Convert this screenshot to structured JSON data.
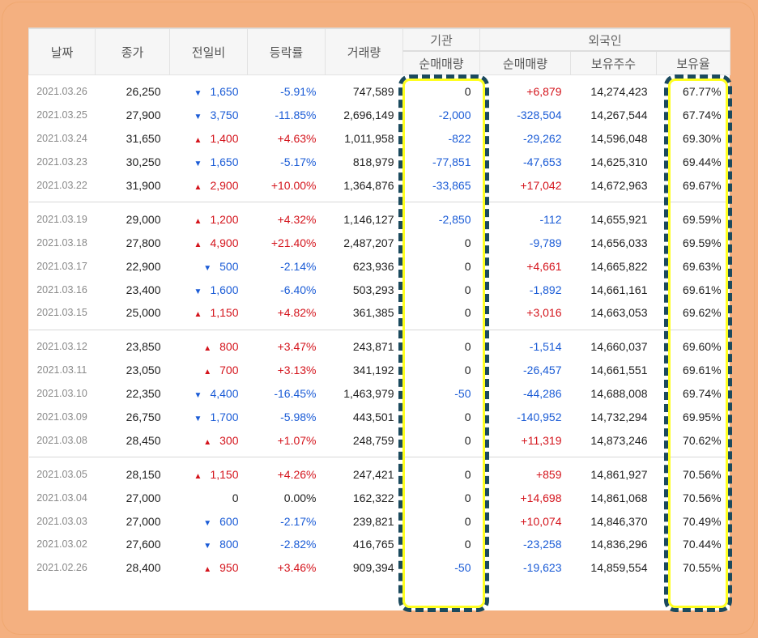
{
  "headers": {
    "date": "날짜",
    "close": "종가",
    "change": "전일비",
    "rate": "등락률",
    "volume": "거래량",
    "institution": "기관",
    "foreign": "외국인",
    "inst_net": "순매매량",
    "foreign_net": "순매매량",
    "foreign_shares": "보유주수",
    "foreign_ratio": "보유율"
  },
  "groups": [
    [
      {
        "date": "2021.03.26",
        "close": "26,250",
        "dir": "down",
        "change": "1,650",
        "rate": "-5.91%",
        "volume": "747,589",
        "inst": "0",
        "foreign": "+6,879",
        "shares": "14,274,423",
        "ratio": "67.77%"
      },
      {
        "date": "2021.03.25",
        "close": "27,900",
        "dir": "down",
        "change": "3,750",
        "rate": "-11.85%",
        "volume": "2,696,149",
        "inst": "-2,000",
        "foreign": "-328,504",
        "shares": "14,267,544",
        "ratio": "67.74%"
      },
      {
        "date": "2021.03.24",
        "close": "31,650",
        "dir": "up",
        "change": "1,400",
        "rate": "+4.63%",
        "volume": "1,011,958",
        "inst": "-822",
        "foreign": "-29,262",
        "shares": "14,596,048",
        "ratio": "69.30%"
      },
      {
        "date": "2021.03.23",
        "close": "30,250",
        "dir": "down",
        "change": "1,650",
        "rate": "-5.17%",
        "volume": "818,979",
        "inst": "-77,851",
        "foreign": "-47,653",
        "shares": "14,625,310",
        "ratio": "69.44%"
      },
      {
        "date": "2021.03.22",
        "close": "31,900",
        "dir": "up",
        "change": "2,900",
        "rate": "+10.00%",
        "volume": "1,364,876",
        "inst": "-33,865",
        "foreign": "+17,042",
        "shares": "14,672,963",
        "ratio": "69.67%"
      }
    ],
    [
      {
        "date": "2021.03.19",
        "close": "29,000",
        "dir": "up",
        "change": "1,200",
        "rate": "+4.32%",
        "volume": "1,146,127",
        "inst": "-2,850",
        "foreign": "-112",
        "shares": "14,655,921",
        "ratio": "69.59%"
      },
      {
        "date": "2021.03.18",
        "close": "27,800",
        "dir": "up",
        "change": "4,900",
        "rate": "+21.40%",
        "volume": "2,487,207",
        "inst": "0",
        "foreign": "-9,789",
        "shares": "14,656,033",
        "ratio": "69.59%"
      },
      {
        "date": "2021.03.17",
        "close": "22,900",
        "dir": "down",
        "change": "500",
        "rate": "-2.14%",
        "volume": "623,936",
        "inst": "0",
        "foreign": "+4,661",
        "shares": "14,665,822",
        "ratio": "69.63%"
      },
      {
        "date": "2021.03.16",
        "close": "23,400",
        "dir": "down",
        "change": "1,600",
        "rate": "-6.40%",
        "volume": "503,293",
        "inst": "0",
        "foreign": "-1,892",
        "shares": "14,661,161",
        "ratio": "69.61%"
      },
      {
        "date": "2021.03.15",
        "close": "25,000",
        "dir": "up",
        "change": "1,150",
        "rate": "+4.82%",
        "volume": "361,385",
        "inst": "0",
        "foreign": "+3,016",
        "shares": "14,663,053",
        "ratio": "69.62%"
      }
    ],
    [
      {
        "date": "2021.03.12",
        "close": "23,850",
        "dir": "up",
        "change": "800",
        "rate": "+3.47%",
        "volume": "243,871",
        "inst": "0",
        "foreign": "-1,514",
        "shares": "14,660,037",
        "ratio": "69.60%"
      },
      {
        "date": "2021.03.11",
        "close": "23,050",
        "dir": "up",
        "change": "700",
        "rate": "+3.13%",
        "volume": "341,192",
        "inst": "0",
        "foreign": "-26,457",
        "shares": "14,661,551",
        "ratio": "69.61%"
      },
      {
        "date": "2021.03.10",
        "close": "22,350",
        "dir": "down",
        "change": "4,400",
        "rate": "-16.45%",
        "volume": "1,463,979",
        "inst": "-50",
        "foreign": "-44,286",
        "shares": "14,688,008",
        "ratio": "69.74%"
      },
      {
        "date": "2021.03.09",
        "close": "26,750",
        "dir": "down",
        "change": "1,700",
        "rate": "-5.98%",
        "volume": "443,501",
        "inst": "0",
        "foreign": "-140,952",
        "shares": "14,732,294",
        "ratio": "69.95%"
      },
      {
        "date": "2021.03.08",
        "close": "28,450",
        "dir": "up",
        "change": "300",
        "rate": "+1.07%",
        "volume": "248,759",
        "inst": "0",
        "foreign": "+11,319",
        "shares": "14,873,246",
        "ratio": "70.62%"
      }
    ],
    [
      {
        "date": "2021.03.05",
        "close": "28,150",
        "dir": "up",
        "change": "1,150",
        "rate": "+4.26%",
        "volume": "247,421",
        "inst": "0",
        "foreign": "+859",
        "shares": "14,861,927",
        "ratio": "70.56%"
      },
      {
        "date": "2021.03.04",
        "close": "27,000",
        "dir": "none",
        "change": "0",
        "rate": "0.00%",
        "volume": "162,322",
        "inst": "0",
        "foreign": "+14,698",
        "shares": "14,861,068",
        "ratio": "70.56%"
      },
      {
        "date": "2021.03.03",
        "close": "27,000",
        "dir": "down",
        "change": "600",
        "rate": "-2.17%",
        "volume": "239,821",
        "inst": "0",
        "foreign": "+10,074",
        "shares": "14,846,370",
        "ratio": "70.49%"
      },
      {
        "date": "2021.03.02",
        "close": "27,600",
        "dir": "down",
        "change": "800",
        "rate": "-2.82%",
        "volume": "416,765",
        "inst": "0",
        "foreign": "-23,258",
        "shares": "14,836,296",
        "ratio": "70.44%"
      },
      {
        "date": "2021.02.26",
        "close": "28,400",
        "dir": "up",
        "change": "950",
        "rate": "+3.46%",
        "volume": "909,394",
        "inst": "-50",
        "foreign": "-19,623",
        "shares": "14,859,554",
        "ratio": "70.55%"
      }
    ]
  ],
  "colors": {
    "up": "#d4141c",
    "down": "#1a5bd6",
    "highlight_border": "#1b4a5e",
    "highlight_glow": "#ffff20",
    "background": "#f4b080"
  },
  "icons": {
    "up": "triangle-up-icon",
    "down": "triangle-down-icon"
  }
}
